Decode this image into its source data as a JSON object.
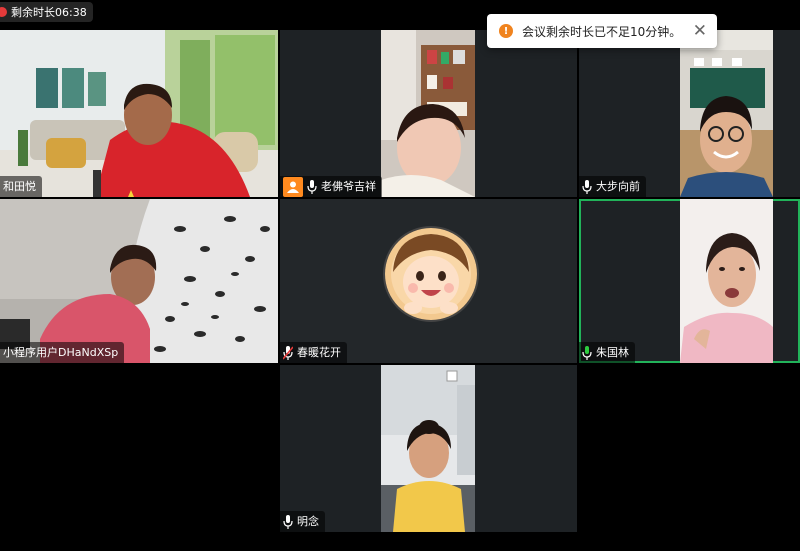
{
  "timer": {
    "label": "剩余时长06:38"
  },
  "toast": {
    "message": "会议剩余时长已不足10分钟。",
    "close": "✕",
    "warn": "!"
  },
  "participants": [
    {
      "name": "和田悦"
    },
    {
      "name": "老佛爷吉祥"
    },
    {
      "name": "大步向前"
    },
    {
      "name": "小程序用户DHaNdXSp"
    },
    {
      "name": "春暖花开"
    },
    {
      "name": "朱国林"
    },
    {
      "name": "明念"
    }
  ],
  "colors": {
    "speaking_border": "#22b35a",
    "host_badge": "#ff8a1f",
    "mic_active": "#2ecc40",
    "muted": "#e53a3a"
  }
}
